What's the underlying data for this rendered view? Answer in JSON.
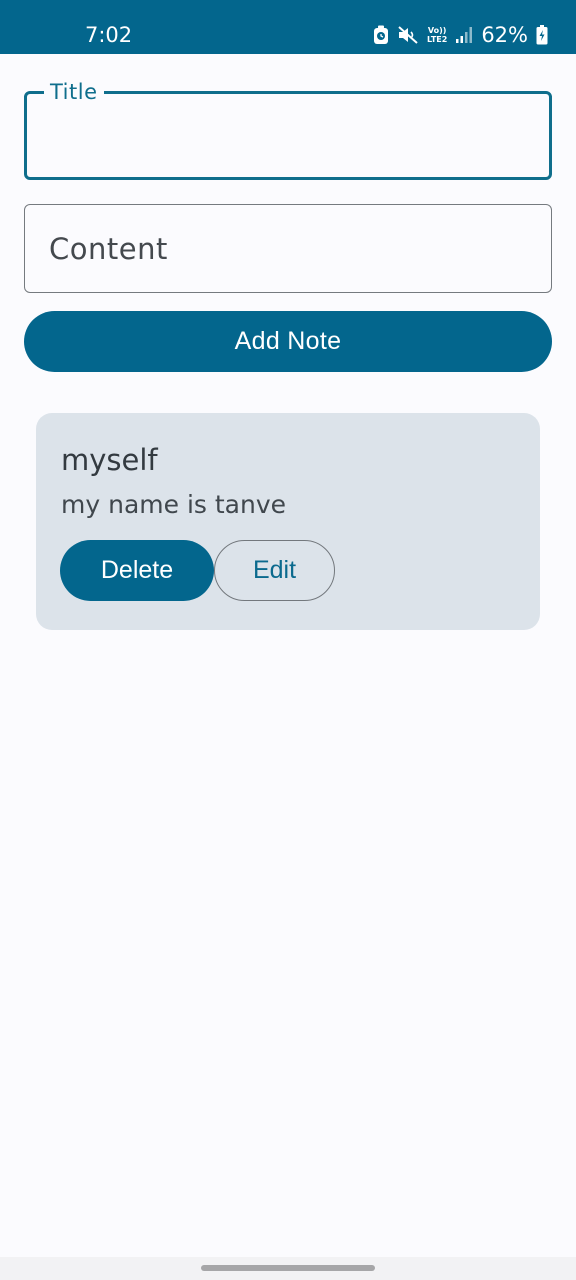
{
  "status_bar": {
    "time": "7:02",
    "network_top": "Vo))",
    "network_bottom": "LTE2",
    "battery": "62%",
    "icons": [
      "alarm-icon",
      "mute-icon",
      "signal-icon",
      "battery-icon"
    ]
  },
  "form": {
    "title_label": "Title",
    "title_value": "",
    "content_placeholder": "Content",
    "add_button_label": "Add Note"
  },
  "notes": [
    {
      "title": "myself",
      "content": "my name is tanve",
      "delete_label": "Delete",
      "edit_label": "Edit"
    }
  ],
  "colors": {
    "primary": "#03668d",
    "card_background": "#dce3ea",
    "page_background": "#fbfbfe"
  }
}
